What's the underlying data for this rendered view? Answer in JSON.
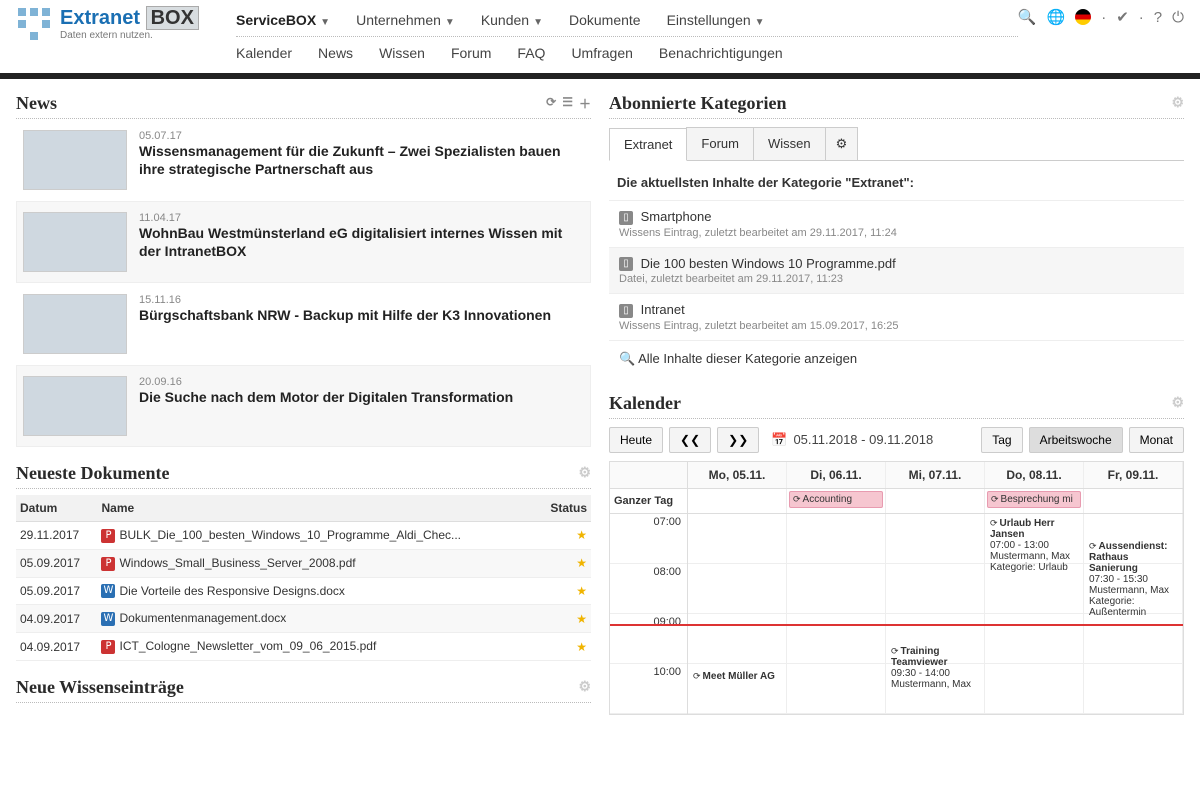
{
  "logo": {
    "main_a": "Extranet",
    "main_b": "BOX",
    "sub": "Daten extern nutzen."
  },
  "nav1": [
    {
      "label": "ServiceBOX",
      "dd": true,
      "active": true
    },
    {
      "label": "Unternehmen",
      "dd": true
    },
    {
      "label": "Kunden",
      "dd": true
    },
    {
      "label": "Dokumente",
      "dd": false
    },
    {
      "label": "Einstellungen",
      "dd": true
    }
  ],
  "nav2": [
    "Kalender",
    "News",
    "Wissen",
    "Forum",
    "FAQ",
    "Umfragen",
    "Benachrichtigungen"
  ],
  "news_title": "News",
  "news": [
    {
      "date": "05.07.17",
      "title": "Wissensmanagement für die Zukunft – Zwei Spezialisten bauen ihre strategische Partnerschaft aus",
      "alt": false
    },
    {
      "date": "11.04.17",
      "title": "WohnBau Westmünsterland eG digitalisiert internes Wissen mit der IntranetBOX",
      "alt": true
    },
    {
      "date": "15.11.16",
      "title": "Bürgschaftsbank NRW - Backup mit Hilfe der K3 Innovationen",
      "alt": false
    },
    {
      "date": "20.09.16",
      "title": "Die Suche nach dem Motor der Digitalen Transformation",
      "alt": true
    }
  ],
  "docs_title": "Neueste Dokumente",
  "docs_headers": {
    "date": "Datum",
    "name": "Name",
    "status": "Status"
  },
  "docs": [
    {
      "date": "29.11.2017",
      "name": "BULK_Die_100_besten_Windows_10_Programme_Aldi_Chec...",
      "type": "pdf",
      "alt": false
    },
    {
      "date": "05.09.2017",
      "name": "Windows_Small_Business_Server_2008.pdf",
      "type": "pdf",
      "alt": true
    },
    {
      "date": "05.09.2017",
      "name": "Die Vorteile des Responsive Designs.docx",
      "type": "doc",
      "alt": false
    },
    {
      "date": "04.09.2017",
      "name": "Dokumentenmanagement.docx",
      "type": "doc",
      "alt": true
    },
    {
      "date": "04.09.2017",
      "name": "ICT_Cologne_Newsletter_vom_09_06_2015.pdf",
      "type": "pdf",
      "alt": false
    }
  ],
  "wissen_title": "Neue Wissenseinträge",
  "cat_title": "Abonnierte Kategorien",
  "cat_tabs": [
    "Extranet",
    "Forum",
    "Wissen"
  ],
  "cat_intro": "Die aktuellsten Inhalte der Kategorie \"Extranet\":",
  "cat_items": [
    {
      "title": "Smartphone",
      "meta": "Wissens Eintrag, zuletzt bearbeitet am 29.11.2017, 11:24",
      "alt": false
    },
    {
      "title": "Die 100 besten Windows 10 Programme.pdf",
      "meta": "Datei, zuletzt bearbeitet am 29.11.2017, 11:23",
      "alt": true
    },
    {
      "title": "Intranet",
      "meta": "Wissens Eintrag, zuletzt bearbeitet am 15.09.2017, 16:25",
      "alt": false
    }
  ],
  "cat_all": "Alle Inhalte dieser Kategorie anzeigen",
  "cal_title": "Kalender",
  "cal_today": "Heute",
  "cal_range": "05.11.2018 - 09.11.2018",
  "cal_views": {
    "day": "Tag",
    "week": "Arbeitswoche",
    "month": "Monat"
  },
  "cal_days": [
    "Mo, 05.11.",
    "Di, 06.11.",
    "Mi, 07.11.",
    "Do, 08.11.",
    "Fr, 09.11."
  ],
  "cal_allday_label": "Ganzer Tag",
  "cal_allday": {
    "1": {
      "text": "Accounting",
      "cls": "pink"
    },
    "3": {
      "text": "Besprechung mi",
      "cls": "pink"
    }
  },
  "cal_hours": [
    "07:00",
    "08:00",
    "09:00",
    "10:00"
  ],
  "cal_events": {
    "urlaub": {
      "title": "Urlaub Herr Jansen",
      "time": "07:00 - 13:00",
      "who": "Mustermann, Max",
      "cat": "Kategorie: Urlaub"
    },
    "aussen": {
      "title": "Aussendienst: Rathaus Sanierung",
      "time": "07:30 - 15:30",
      "who": "Mustermann, Max",
      "cat": "Kategorie: Außentermin"
    },
    "training": {
      "title": "Training Teamviewer",
      "time": "09:30 - 14:00",
      "who": "Mustermann, Max"
    },
    "meet": {
      "title": "Meet Müller AG"
    }
  }
}
